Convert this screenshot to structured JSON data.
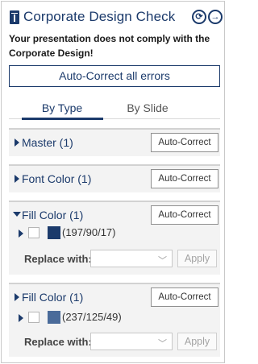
{
  "header": {
    "title": "Corporate Design Check",
    "refresh_icon": "refresh-icon",
    "next_icon": "arrow-right-circle-icon"
  },
  "warning": "Your presentation does not comply with the Corporate Design!",
  "auto_correct_all": "Auto-Correct all errors",
  "tabs": [
    {
      "label": "By Type",
      "active": true
    },
    {
      "label": "By Slide",
      "active": false
    }
  ],
  "sections": [
    {
      "label": "Master (1)",
      "expanded": false,
      "button": "Auto-Correct"
    },
    {
      "label": "Font Color (1)",
      "expanded": false,
      "button": "Auto-Correct"
    },
    {
      "label": "Fill Color (1)",
      "expanded": true,
      "button": "Auto-Correct",
      "item": {
        "color_text": "(197/90/17)",
        "swatch": "#1b3a6b"
      },
      "replace_label": "Replace with:",
      "apply": "Apply"
    },
    {
      "label": "Fill Color (1)",
      "expanded": false,
      "button": "Auto-Correct",
      "item": {
        "color_text": "(237/125/49)",
        "swatch": "#4a6b9a"
      },
      "replace_label": "Replace with:",
      "apply": "Apply"
    }
  ],
  "colors": {
    "accent": "#1b3a6b",
    "panel": "#f3f3f3"
  }
}
